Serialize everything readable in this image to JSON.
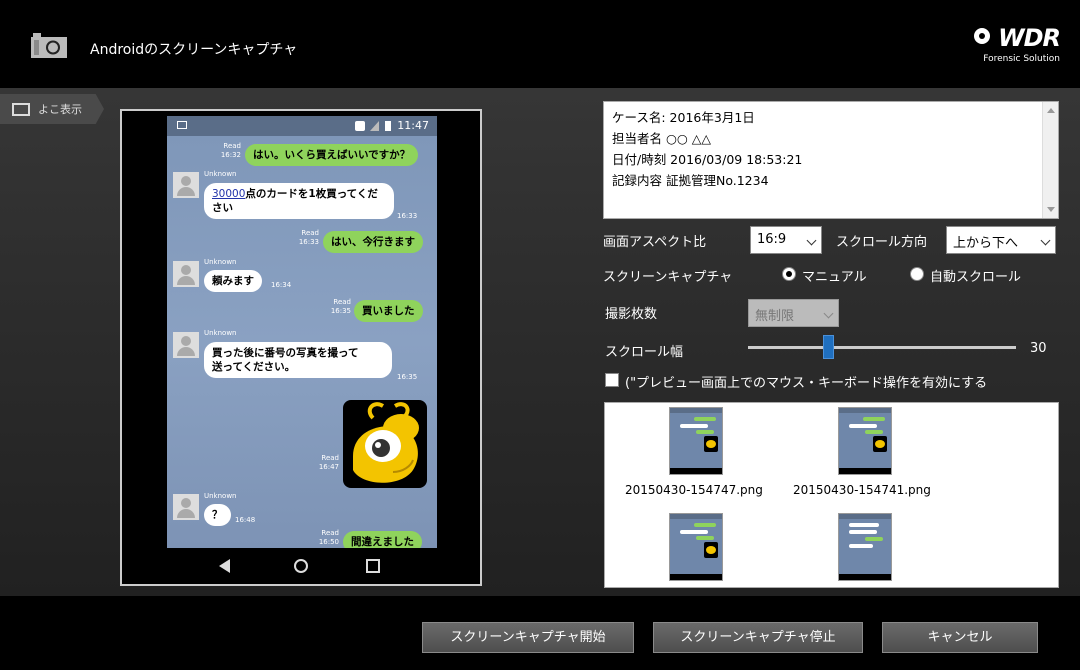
{
  "window": {
    "title": "Androidのスクリーンキャプチャ"
  },
  "brand": {
    "logo": "WDR",
    "subtitle": "Forensic Solution"
  },
  "view_toggle": {
    "label": "よこ表示"
  },
  "phone": {
    "status_time": "11:47",
    "messages": [
      {
        "dir": "out",
        "meta_status": "Read",
        "time": "16:32",
        "text": "はい。いくら買えばいいですか？"
      },
      {
        "dir": "in",
        "sender": "Unknown",
        "time": "16:33",
        "number": "30000",
        "text": "点のカードを1枚買ってください"
      },
      {
        "dir": "out",
        "meta_status": "Read",
        "time": "16:33",
        "text": "はい、今行きます"
      },
      {
        "dir": "in",
        "sender": "Unknown",
        "time": "16:34",
        "text": "頼みます"
      },
      {
        "dir": "out",
        "meta_status": "Read",
        "time": "16:35",
        "text": "買いました"
      },
      {
        "dir": "in",
        "sender": "Unknown",
        "time": "16:35",
        "text_line1": "買った後に番号の写真を撮って",
        "text_line2": "送ってください。"
      },
      {
        "dir": "out",
        "meta_status": "Read",
        "time": "16:47",
        "sticker": true
      },
      {
        "dir": "in",
        "sender": "Unknown",
        "time": "16:48",
        "text": "？"
      },
      {
        "dir": "out",
        "meta_status": "Read",
        "time": "16:50",
        "text": "間違えました"
      }
    ]
  },
  "case_info": {
    "lines": [
      "ケース名:  2016年3月1日",
      "担当者名  ○○    △△",
      "日付/時刻  2016/03/09   18:53:21",
      "記録内容  証拠管理No.1234"
    ]
  },
  "settings": {
    "aspect_label": "画面アスペクト比",
    "aspect_value": "16:9",
    "scroll_dir_label": "スクロール方向",
    "scroll_dir_value": "上から下へ",
    "capture_label": "スクリーンキャプチャ",
    "capture_manual": "マニュアル",
    "capture_auto": "自動スクロール",
    "capture_selected": "manual",
    "count_label": "撮影枚数",
    "count_value": "無制限",
    "scroll_width_label": "スクロール幅",
    "scroll_width_value": "30",
    "scroll_width_fraction": 0.3,
    "mouse_label": "(\"プレビュー画面上でのマウス・キーボード操作を有効にする",
    "mouse_checked": false
  },
  "captures": [
    {
      "name": "20150430-154747.png"
    },
    {
      "name": "20150430-154741.png"
    },
    {
      "name": ""
    },
    {
      "name": ""
    }
  ],
  "buttons": {
    "start": "スクリーンキャプチャ開始",
    "stop": "スクリーンキャプチャ停止",
    "cancel": "キャンセル"
  },
  "colors": {
    "accent": "#1f6fbf",
    "bubble_out": "#8fd35c",
    "chat_bg": "#7f97b9"
  }
}
